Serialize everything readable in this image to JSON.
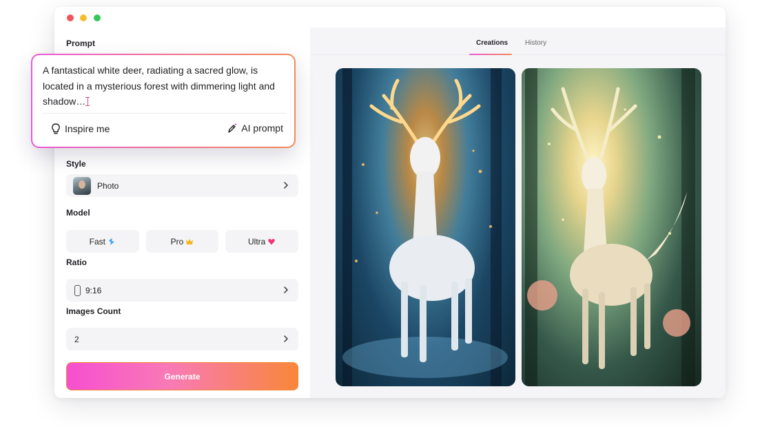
{
  "window": {
    "controls": [
      "close",
      "minimize",
      "maximize"
    ]
  },
  "prompt": {
    "label": "Prompt",
    "text": "A fantastical white deer, radiating a sacred glow, is located in a mysterious forest with dimmering light and shadow…",
    "inspire_label": "Inspire me",
    "ai_prompt_label": "AI prompt"
  },
  "style": {
    "label": "Style",
    "value": "Photo"
  },
  "model": {
    "label": "Model",
    "options": [
      {
        "label": "Fast",
        "icon": "bolt-icon",
        "color": "#3aa0f0"
      },
      {
        "label": "Pro",
        "icon": "crown-icon",
        "color": "#f5b31f"
      },
      {
        "label": "Ultra",
        "icon": "heart-gem-icon",
        "color": "#f0357a"
      }
    ]
  },
  "ratio": {
    "label": "Ratio",
    "value": "9:16"
  },
  "images_count": {
    "label": "Images Count",
    "value": "2"
  },
  "generate_label": "Generate",
  "tabs": [
    {
      "label": "Creations",
      "active": true
    },
    {
      "label": "History",
      "active": false
    }
  ],
  "colors": {
    "accent_start": "#f64fd0",
    "accent_end": "#f8873a"
  }
}
